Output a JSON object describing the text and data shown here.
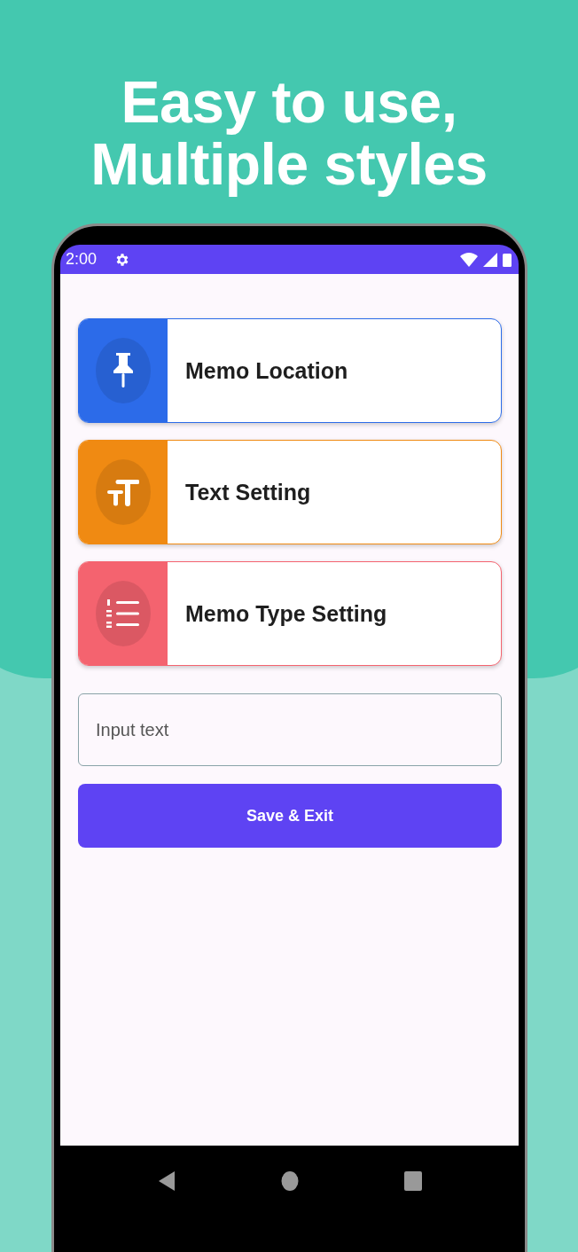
{
  "headline": [
    "Easy to use,",
    "Multiple styles"
  ],
  "status_bar": {
    "time": "2:00"
  },
  "menu": [
    {
      "label": "Memo Location",
      "color": "#2c6be9",
      "kind": "pin"
    },
    {
      "label": "Text Setting",
      "color": "#f08a12",
      "kind": "text"
    },
    {
      "label": "Memo Type Setting",
      "color": "#f4636f",
      "kind": "list"
    }
  ],
  "input": {
    "placeholder": "Input text"
  },
  "save_button": {
    "label": "Save & Exit"
  }
}
